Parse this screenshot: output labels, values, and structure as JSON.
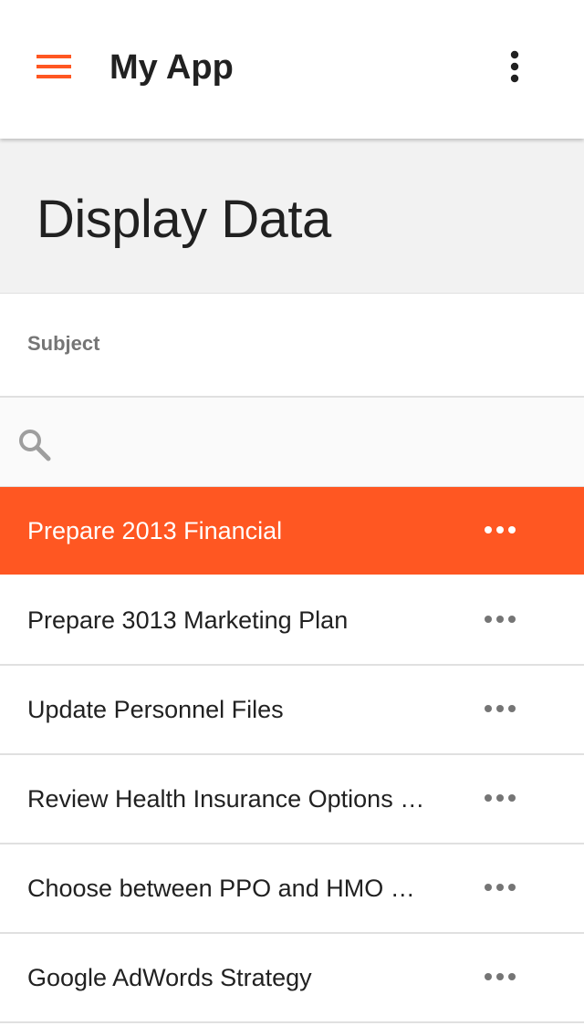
{
  "app": {
    "title": "My App",
    "accent_color": "#ff5722",
    "menu_icon": "hamburger-menu-icon",
    "overflow_icon": "more-vert-icon"
  },
  "page": {
    "title": "Display Data"
  },
  "table": {
    "column_header": "Subject",
    "search": {
      "icon": "search-icon",
      "value": "",
      "placeholder": ""
    },
    "row_action_icon": "more-horiz-icon",
    "rows": [
      {
        "subject": "Prepare 2013 Financial",
        "selected": true
      },
      {
        "subject": "Prepare 3013 Marketing Plan",
        "selected": false
      },
      {
        "subject": "Update Personnel Files",
        "selected": false
      },
      {
        "subject": "Review Health Insurance Options Under the Affordable Care Act",
        "selected": false
      },
      {
        "subject": "Choose between PPO and HMO Health Plan",
        "selected": false
      },
      {
        "subject": "Google AdWords Strategy",
        "selected": false
      }
    ]
  }
}
